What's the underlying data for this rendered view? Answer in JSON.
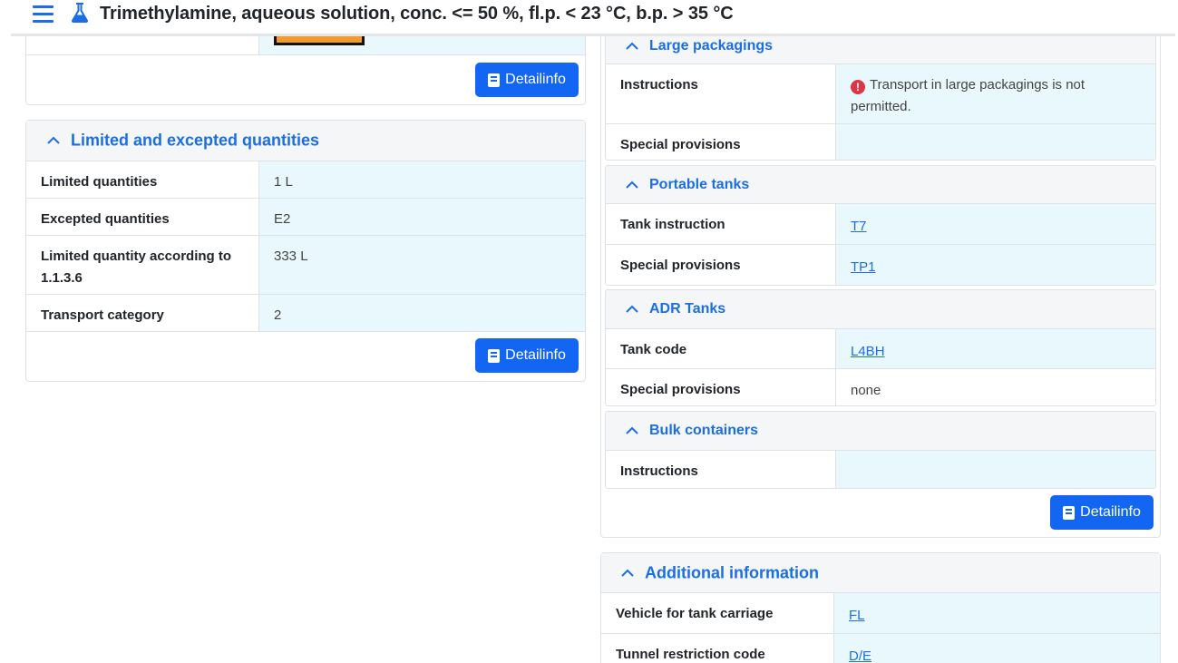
{
  "header": {
    "title": "Trimethylamine, aqueous solution, conc. <= 50 %, fl.p. < 23 °C, b.p. > 35 °C"
  },
  "detailinfo_label": "Detailinfo",
  "limited": {
    "title": "Limited and excepted quantities",
    "rows": [
      {
        "label": "Limited quantities",
        "value": "1 L"
      },
      {
        "label": "Excepted quantities",
        "value": "E2"
      },
      {
        "label": "Limited quantity according to 1.1.3.6",
        "value": "333 L"
      },
      {
        "label": "Transport category",
        "value": "2"
      }
    ]
  },
  "large_packagings": {
    "title": "Large packagings",
    "instructions_label": "Instructions",
    "instructions_value": "Transport in large packagings is not permitted.",
    "special_label": "Special provisions",
    "special_value": ""
  },
  "portable_tanks": {
    "title": "Portable tanks",
    "rows": [
      {
        "label": "Tank instruction",
        "value": "T7"
      },
      {
        "label": "Special provisions",
        "value": "TP1"
      }
    ]
  },
  "adr_tanks": {
    "title": "ADR Tanks",
    "rows": [
      {
        "label": "Tank code",
        "value": "L4BH"
      },
      {
        "label": "Special provisions",
        "value": "none"
      }
    ]
  },
  "bulk": {
    "title": "Bulk containers",
    "instructions_label": "Instructions",
    "instructions_value": ""
  },
  "additional": {
    "title": "Additional information",
    "rows": [
      {
        "label": "Vehicle for tank carriage",
        "value": "FL"
      },
      {
        "label": "Tunnel restriction code",
        "value": "D/E"
      }
    ]
  },
  "colors": {
    "accent": "#1c6fe0",
    "button": "#1266f1",
    "value_bg": "#e9f8fc",
    "header_bg": "#f4f6f7",
    "danger": "#dc3545"
  }
}
